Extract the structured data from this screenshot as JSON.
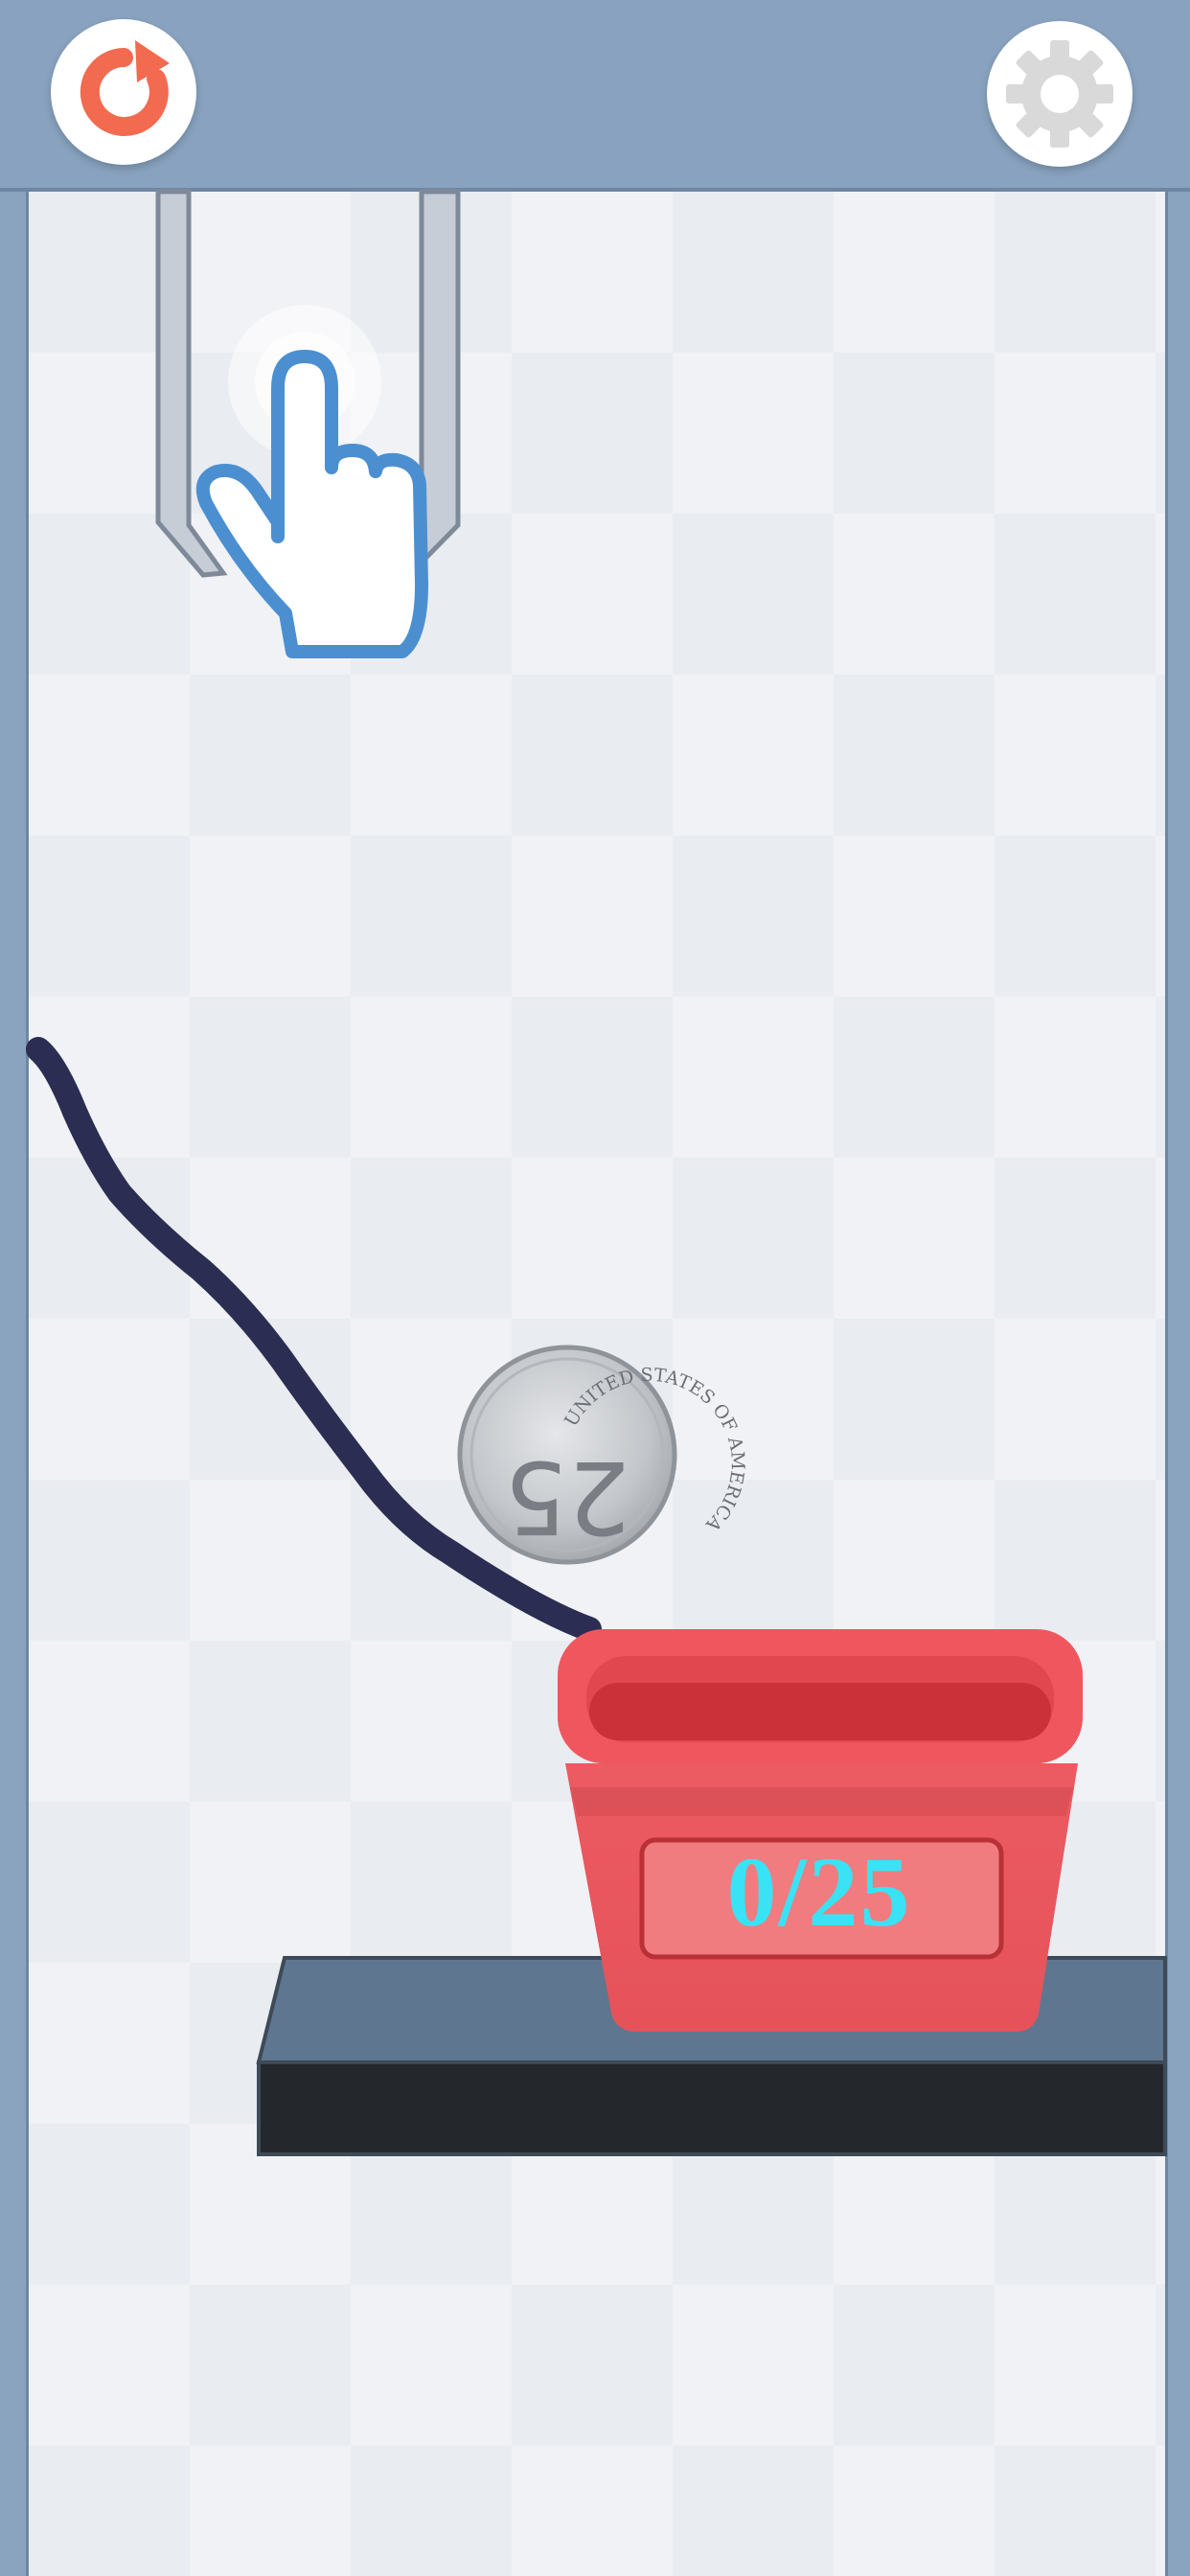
{
  "toolbar": {
    "restart_icon": "restart-icon",
    "settings_icon": "gear-icon"
  },
  "cup": {
    "counter": "0/25",
    "color": "#e9555c",
    "counter_color": "#39e3f5"
  },
  "coin": {
    "denomination": "25",
    "inscription": "UNITED STATES OF AMERICA"
  },
  "colors": {
    "wall": "#8aa3bf",
    "drawn_line": "#2b2d52",
    "platform_top": "#5f7690",
    "platform_front": "#24282d"
  }
}
